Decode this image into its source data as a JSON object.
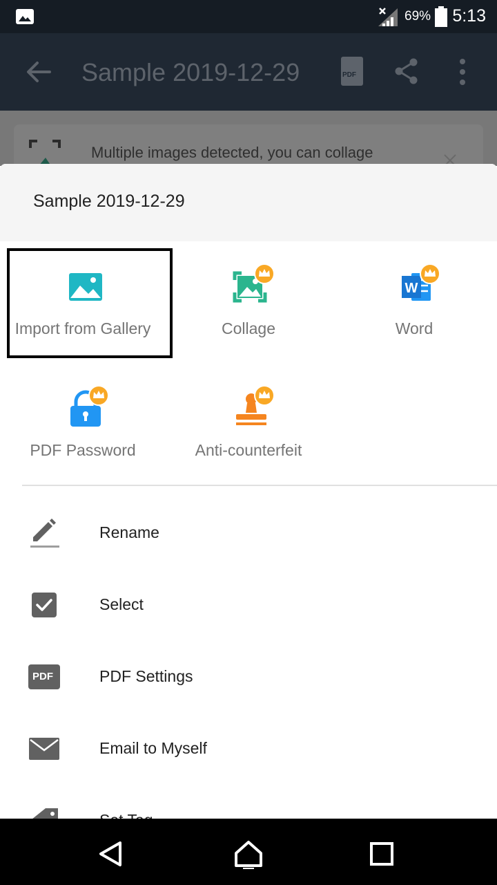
{
  "status_bar": {
    "battery_percent": "69%",
    "time": "5:13"
  },
  "app_bar": {
    "title": "Sample 2019-12-29",
    "pdf_icon_text": "PDF"
  },
  "banner": {
    "text": "Multiple images detected, you can collage"
  },
  "sheet": {
    "title": "Sample 2019-12-29",
    "grid": [
      {
        "label": "Import from Gallery",
        "icon": "gallery-icon",
        "premium": false
      },
      {
        "label": "Collage",
        "icon": "collage-icon",
        "premium": true
      },
      {
        "label": "Word",
        "icon": "word-icon",
        "premium": true
      },
      {
        "label": "PDF Password",
        "icon": "lock-icon",
        "premium": true
      },
      {
        "label": "Anti-counterfeit",
        "icon": "stamp-icon",
        "premium": true
      }
    ],
    "list": [
      {
        "label": "Rename",
        "icon": "pencil-icon"
      },
      {
        "label": "Select",
        "icon": "checkbox-icon"
      },
      {
        "label": "PDF Settings",
        "icon": "pdf-settings-icon",
        "icon_text": "PDF"
      },
      {
        "label": "Email to Myself",
        "icon": "email-icon"
      },
      {
        "label": "Set Tag",
        "icon": "tag-icon"
      }
    ]
  },
  "colors": {
    "teal": "#1fb7c4",
    "green": "#2bb58e",
    "blue": "#2196f3",
    "orange": "#f5851f",
    "crown": "#f9a825"
  }
}
